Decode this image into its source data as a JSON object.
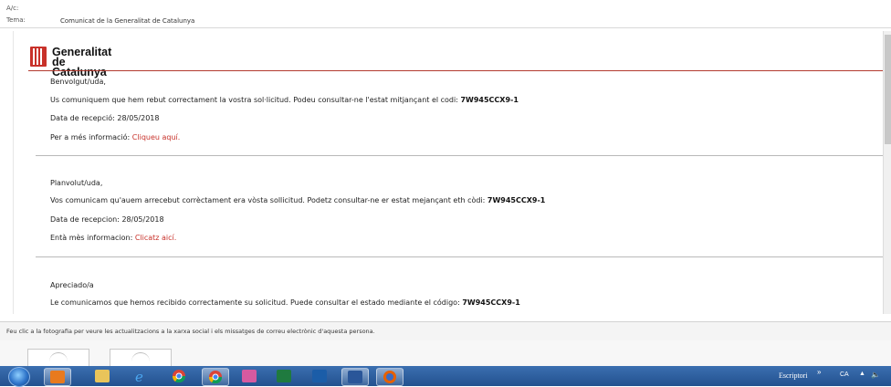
{
  "header": {
    "cc_label": "A/c:",
    "subject_label": "Tema:",
    "subject_value": "Comunicat de la Generalitat de Catalunya"
  },
  "logo": {
    "line1": "Generalitat",
    "line2": "de Catalunya",
    "color": "#c8312a"
  },
  "catalan": {
    "greeting": "Benvolgut/uda,",
    "body": "Us comuniquem que hem rebut correctament la vostra sol·licitud. Podeu consultar-ne l'estat mitjançant el codi:",
    "code": "7W945CCX9-1",
    "date": "Data de recepció: 28/05/2018",
    "info": "Per a més informació:",
    "link": "Cliqueu aquí."
  },
  "aranese": {
    "greeting": "Planvolut/uda,",
    "body": "Vos comunicam qu'auem arrecebut corrèctament era vòsta sollicitud. Podetz consultar-ne er estat mejançant eth còdi:",
    "code": "7W945CCX9-1",
    "date": "Data de recepcion: 28/05/2018",
    "info": "Entà mès informacion:",
    "link": "Clicatz aicí."
  },
  "spanish": {
    "greeting": "Apreciado/a",
    "body": "Le comunicamos que hemos recibido correctamente su solicitud. Puede consultar el estado mediante el código:",
    "code": "7W945CCX9-1"
  },
  "people_pane": {
    "hint": "Feu clic a la fotografia per veure les actualitzacions a la xarxa social i els missatges de correu electrònic d'aquesta persona."
  },
  "taskbar": {
    "icons": [
      "windows-start-icon",
      "outlook-icon",
      "file-explorer-icon",
      "internet-explorer-icon",
      "chrome-icon",
      "chrome-icon",
      "paint-icon",
      "excel-icon",
      "app-icon",
      "word-icon",
      "firefox-icon"
    ],
    "desktop_label": "Escriptori",
    "chevron": "»",
    "language": "CA",
    "show_hidden": "▲",
    "volume": "🔈"
  },
  "colors": {
    "link": "#c8312a",
    "accent_line": "#b33a2f",
    "taskbar": "#23518f"
  }
}
